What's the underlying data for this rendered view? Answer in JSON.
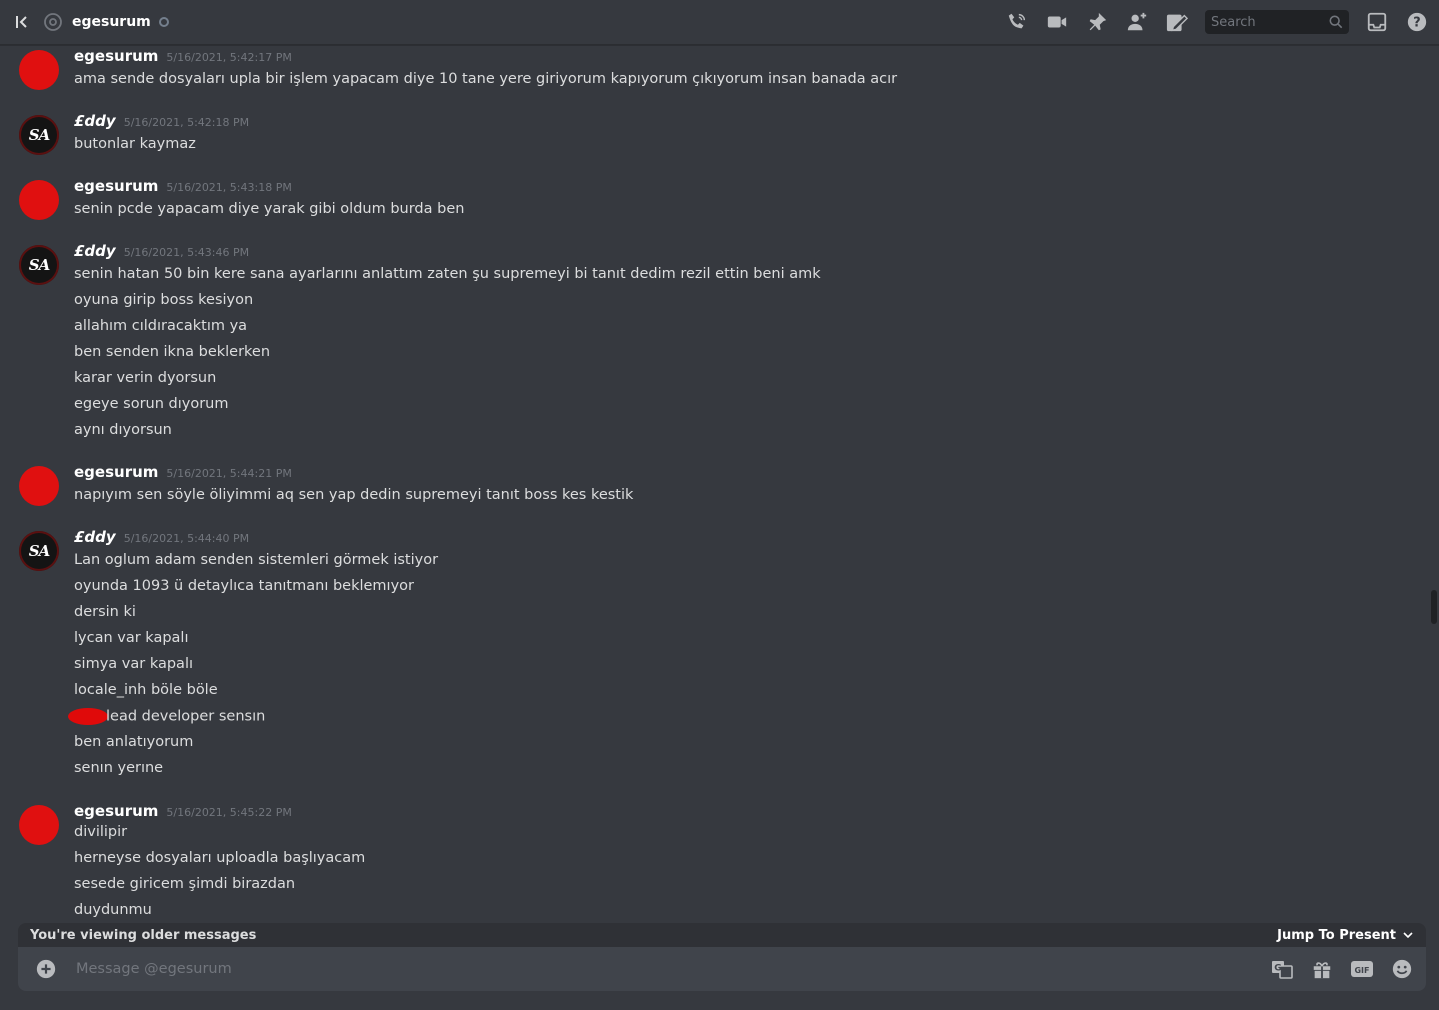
{
  "header": {
    "channel_name": "egesurum",
    "search_placeholder": "Search"
  },
  "groups": [
    {
      "author": "egesurum",
      "avatar": "red-blob-avatar",
      "timestamp": "5/16/2021, 5:42:17 PM",
      "lines": [
        "ama sende dosyaları upla bir işlem yapacam diye 10 tane yere giriyorum kapıyorum çıkıyorum insan banada acır"
      ]
    },
    {
      "author": "£ddy",
      "avatar": "sa-logo-avatar",
      "avatar_text": "SA",
      "timestamp": "5/16/2021, 5:42:18 PM",
      "lines": [
        "butonlar kaymaz"
      ]
    },
    {
      "author": "egesurum",
      "avatar": "red-blob-avatar",
      "timestamp": "5/16/2021, 5:43:18 PM",
      "lines": [
        "senin pcde yapacam diye yarak gibi oldum burda ben"
      ]
    },
    {
      "author": "£ddy",
      "avatar": "sa-logo-avatar",
      "avatar_text": "SA",
      "timestamp": "5/16/2021, 5:43:46 PM",
      "lines": [
        "senin hatan 50 bin kere sana ayarlarını anlattım zaten şu supremeyi bi tanıt dedim rezil ettin beni amk",
        "oyuna girip boss kesiyon",
        "allahım cıldıracaktım ya",
        "ben senden ikna beklerken",
        "karar verin dyorsun",
        "egeye sorun dıyorum",
        "aynı dıyorsun"
      ]
    },
    {
      "author": "egesurum",
      "avatar": "red-blob-avatar",
      "timestamp": "5/16/2021, 5:44:21 PM",
      "lines": [
        "napıyım sen söyle öliyimmi aq sen yap dedin supremeyi tanıt boss kes kestik"
      ]
    },
    {
      "author": "£ddy",
      "avatar": "sa-logo-avatar",
      "avatar_text": "SA",
      "timestamp": "5/16/2021, 5:44:40 PM",
      "lines": [
        "Lan oglum adam senden sistemleri görmek istiyor",
        "oyunda 1093 ü detaylıca tanıtmanı beklemıyor",
        "dersin ki",
        "lycan var kapalı",
        "simya var kapalı",
        "locale_inh böle böle",
        "lead developer sensın",
        "ben anlatıyorum",
        "senın yerıne"
      ]
    },
    {
      "author": "egesurum",
      "avatar": "red-blob-avatar",
      "timestamp": "5/16/2021, 5:45:22 PM",
      "lines": [
        "divilipir",
        "herneyse dosyaları uploadla başlıyacam",
        "sesede giricem şimdi birazdan",
        "duydunmu"
      ]
    }
  ],
  "older_bar": {
    "text": "You're viewing older messages",
    "jump_label": "Jump To Present"
  },
  "composer": {
    "placeholder": "Message @egesurum"
  },
  "colors": {
    "background": "#36393f",
    "composer": "#40444b",
    "older_bar": "#2f3136",
    "avatar_red": "#e01010"
  }
}
